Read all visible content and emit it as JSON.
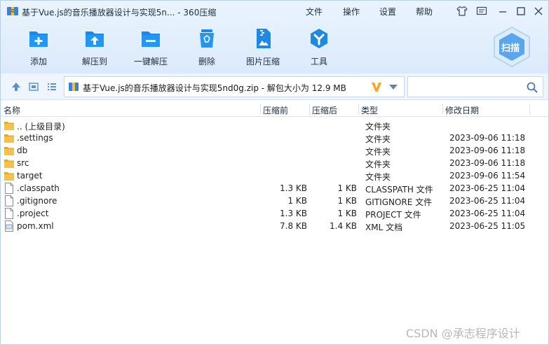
{
  "window": {
    "title": "基于Vue.js的音乐播放器设计与实现5n... - 360压缩",
    "menus": [
      "文件",
      "操作",
      "设置",
      "帮助"
    ]
  },
  "toolbar": {
    "add": "添加",
    "extract_to": "解压到",
    "one_click_extract": "一键解压",
    "delete": "删除",
    "image_compress": "图片压缩",
    "tools": "工具",
    "scan": "扫描"
  },
  "address": {
    "path": "基于Vue.js的音乐播放器设计与实现5nd0g.zip - 解包大小为 12.9 MB",
    "search_placeholder": ""
  },
  "columns": {
    "name": "名称",
    "size": "压缩前",
    "packed": "压缩后",
    "type": "类型",
    "modified": "修改日期"
  },
  "files": [
    {
      "name": ".. (上级目录)",
      "size": "",
      "packed": "",
      "type": "文件夹",
      "modified": "",
      "icon": "folder-icon"
    },
    {
      "name": ".settings",
      "size": "",
      "packed": "",
      "type": "文件夹",
      "modified": "2023-09-06 11:18",
      "icon": "folder-icon"
    },
    {
      "name": "db",
      "size": "",
      "packed": "",
      "type": "文件夹",
      "modified": "2023-09-06 11:18",
      "icon": "folder-icon"
    },
    {
      "name": "src",
      "size": "",
      "packed": "",
      "type": "文件夹",
      "modified": "2023-09-06 11:18",
      "icon": "folder-icon"
    },
    {
      "name": "target",
      "size": "",
      "packed": "",
      "type": "文件夹",
      "modified": "2023-09-06 11:54",
      "icon": "folder-icon"
    },
    {
      "name": ".classpath",
      "size": "1.3 KB",
      "packed": "1 KB",
      "type": "CLASSPATH 文件",
      "modified": "2023-06-25 11:04",
      "icon": "file-icon"
    },
    {
      "name": ".gitignore",
      "size": "1 KB",
      "packed": "1 KB",
      "type": "GITIGNORE 文件",
      "modified": "2023-06-25 11:04",
      "icon": "file-icon"
    },
    {
      "name": ".project",
      "size": "1.3 KB",
      "packed": "1 KB",
      "type": "PROJECT 文件",
      "modified": "2023-06-25 11:04",
      "icon": "file-icon"
    },
    {
      "name": "pom.xml",
      "size": "7.8 KB",
      "packed": "1.4 KB",
      "type": "XML 文档",
      "modified": "2023-06-25 11:05",
      "icon": "xml-file-icon"
    }
  ],
  "watermark": "CSDN @承志程序设计",
  "colors": {
    "accent": "#1e88e5",
    "folder": "#f2c14e",
    "brand_orange": "#f5a623"
  }
}
